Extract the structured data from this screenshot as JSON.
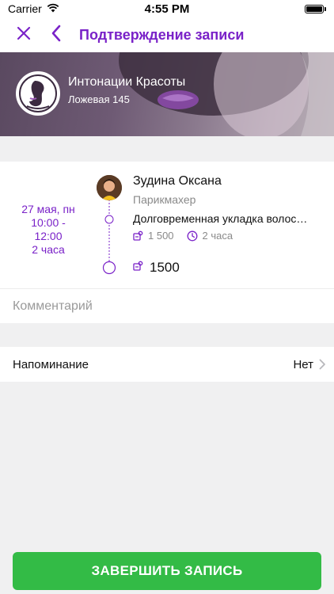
{
  "status_bar": {
    "carrier": "Carrier",
    "time": "4:55 PM",
    "battery_level": 1.0
  },
  "nav": {
    "title": "Подтверждение записи",
    "close_icon": "close-icon",
    "back_icon": "chevron-left-icon"
  },
  "salon": {
    "name": "Интонации Красоты",
    "address": "Ложевая 145"
  },
  "booking": {
    "date": "27 мая, пн",
    "time_start": "10:00 -",
    "time_end": "12:00",
    "duration": "2 часа",
    "master_name": "Зудина Оксана",
    "master_role": "Парикмахер",
    "service_name": "Долговременная укладка волос…",
    "service_price": "1 500",
    "service_duration": "2 часа",
    "total": "1500"
  },
  "comment": {
    "placeholder": "Комментарий",
    "value": ""
  },
  "reminder": {
    "label": "Напоминание",
    "value": "Нет"
  },
  "actions": {
    "complete_label": "ЗАВЕРШИТЬ ЗАПИСЬ"
  },
  "colors": {
    "accent": "#7a22c8",
    "button": "#33bb46",
    "background": "#f0f0f1"
  }
}
